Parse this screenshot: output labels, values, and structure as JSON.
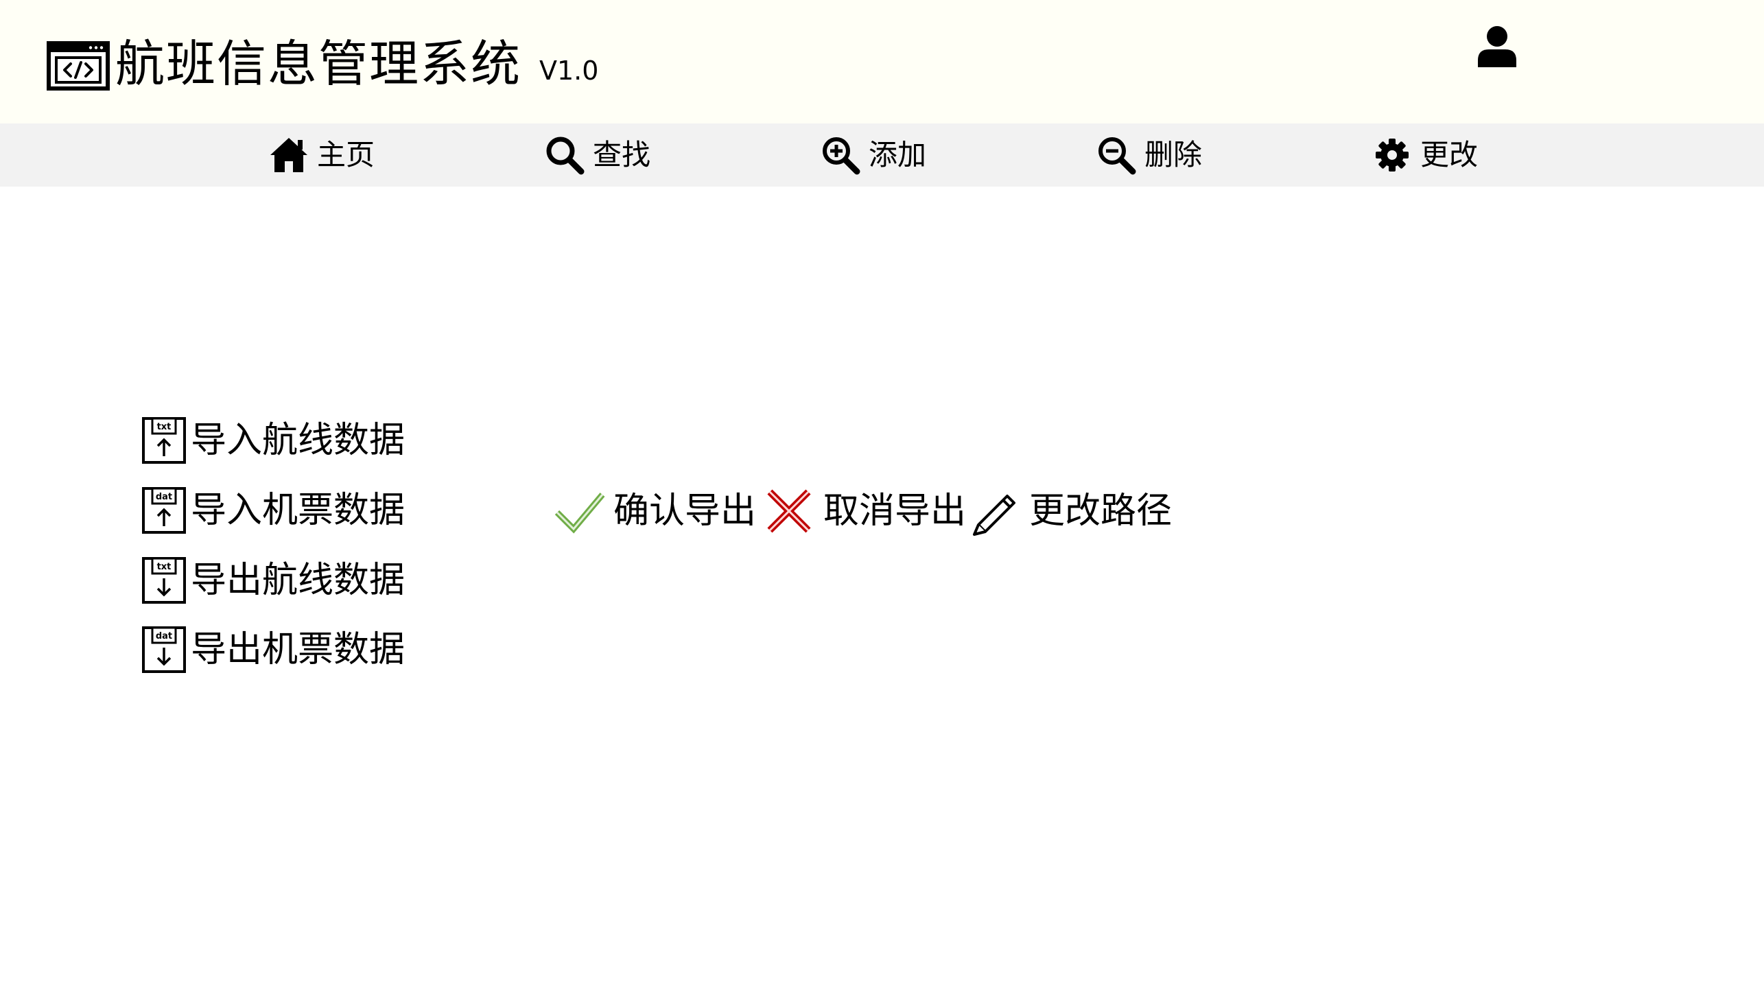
{
  "header": {
    "title": "航班信息管理系统",
    "version": "V1.0",
    "logo_icon": "code-window-icon",
    "user_icon": "user-icon"
  },
  "nav": {
    "items": [
      {
        "label": "主页",
        "icon": "home-icon"
      },
      {
        "label": "查找",
        "icon": "search-icon"
      },
      {
        "label": "添加",
        "icon": "zoom-in-icon"
      },
      {
        "label": "删除",
        "icon": "zoom-out-icon"
      },
      {
        "label": "更改",
        "icon": "gear-icon"
      }
    ]
  },
  "data_actions": {
    "items": [
      {
        "label": "导入航线数据",
        "icon": "txt-upload-icon",
        "file_tag": "txt"
      },
      {
        "label": "导入机票数据",
        "icon": "dat-upload-icon",
        "file_tag": "dat"
      },
      {
        "label": "导出航线数据",
        "icon": "txt-download-icon",
        "file_tag": "txt"
      },
      {
        "label": "导出机票数据",
        "icon": "dat-download-icon",
        "file_tag": "dat"
      }
    ]
  },
  "export_actions": {
    "confirm": {
      "label": "确认导出",
      "icon": "check-icon",
      "color": "#70ad47"
    },
    "cancel": {
      "label": "取消导出",
      "icon": "cross-icon",
      "color": "#c00000"
    },
    "change_path": {
      "label": "更改路径",
      "icon": "pencil-icon"
    }
  }
}
